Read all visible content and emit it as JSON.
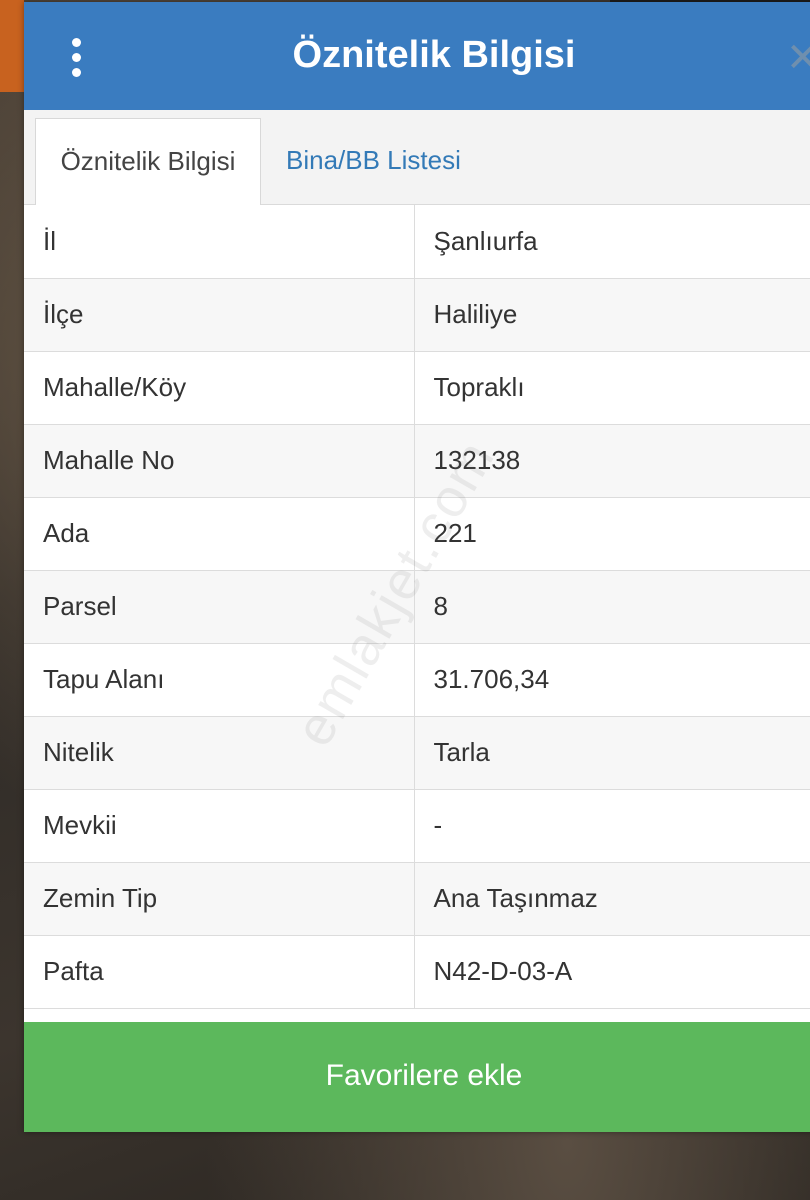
{
  "header": {
    "title": "Öznitelik Bilgisi",
    "menu_icon": "kebab-menu-icon",
    "close_icon": "close-icon",
    "close_glyph": "✕",
    "bg_color": "#3a7cc0"
  },
  "tabs": [
    {
      "label": "Öznitelik Bilgisi",
      "active": true
    },
    {
      "label": "Bina/BB Listesi",
      "active": false
    }
  ],
  "attributes": [
    {
      "key": "İl",
      "value": "Şanlıurfa"
    },
    {
      "key": "İlçe",
      "value": "Haliliye"
    },
    {
      "key": "Mahalle/Köy",
      "value": "Topraklı"
    },
    {
      "key": "Mahalle No",
      "value": "132138"
    },
    {
      "key": "Ada",
      "value": "221"
    },
    {
      "key": "Parsel",
      "value": "8"
    },
    {
      "key": "Tapu Alanı",
      "value": "31.706,34"
    },
    {
      "key": "Nitelik",
      "value": "Tarla"
    },
    {
      "key": "Mevkii",
      "value": "-"
    },
    {
      "key": "Zemin Tip",
      "value": "Ana Taşınmaz"
    },
    {
      "key": "Pafta",
      "value": "N42-D-03-A"
    }
  ],
  "footer": {
    "favorite_label": "Favorilere ekle",
    "button_color": "#5cb85c"
  },
  "watermark": "emlakjet.com"
}
